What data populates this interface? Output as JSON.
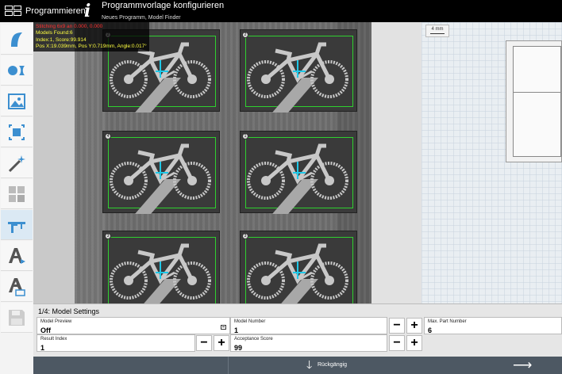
{
  "header": {
    "app_title": "Programmieren",
    "page_title": "Programmvorlage konfigurieren",
    "breadcrumb": "Neues Programm, Model Finder"
  },
  "sidebar": {
    "tools": [
      {
        "icon": "shape-icon"
      },
      {
        "icon": "circle-shapes-icon"
      },
      {
        "icon": "image-icon"
      },
      {
        "icon": "crop-icon"
      },
      {
        "icon": "magic-wand-icon"
      },
      {
        "icon": "pattern-grid-icon"
      },
      {
        "icon": "caliper-icon",
        "active": true
      },
      {
        "icon": "text-a-icon"
      },
      {
        "icon": "text-layers-icon"
      },
      {
        "icon": "save-icon",
        "disabled": true
      }
    ]
  },
  "overlay": {
    "line1": "Stitching 6x9 an 0.000, 0.000",
    "line2": "Models Found:6",
    "line3": "Index:1, Score:99.914",
    "line4": "Pos X:19.039mm, Pos Y:0.719mm, Angle:0.017°"
  },
  "parts": [
    {
      "number": "2"
    },
    {
      "number": "2"
    },
    {
      "number": "4"
    },
    {
      "number": "1"
    },
    {
      "number": "3"
    },
    {
      "number": "3"
    }
  ],
  "right_panel": {
    "scale": "4 mm"
  },
  "settings": {
    "title": "1/4: Model Settings",
    "model_preview": {
      "label": "Model Preview",
      "value": "Off"
    },
    "model_number": {
      "label": "Model Number",
      "value": "1"
    },
    "max_part_number": {
      "label": "Max. Part Number",
      "value": "6"
    },
    "result_index": {
      "label": "Result Index",
      "value": "1"
    },
    "acceptance_score": {
      "label": "Acceptance Score",
      "value": "99"
    },
    "minus": "−",
    "plus": "+"
  },
  "footer": {
    "undo_label": "Rückgängig",
    "undo_arrow": "🡓",
    "next_arrow": "⟶"
  },
  "colors": {
    "roi": "#2fd02f",
    "accent": "#dbe9f4",
    "bottom_bar": "#4d5863"
  }
}
